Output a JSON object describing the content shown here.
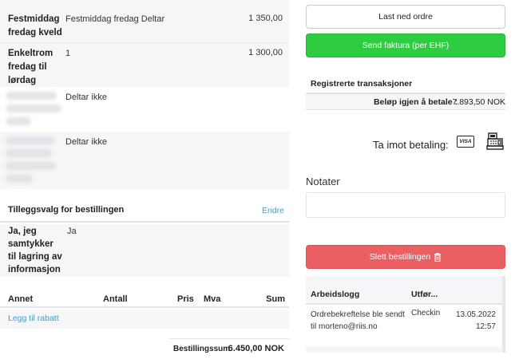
{
  "order_items": [
    {
      "name": "Festmiddag fredag kveld",
      "desc": "Festmiddag fredag Deltar",
      "amount": "1 350,00"
    },
    {
      "name": "Enkeltrom fredag til lørdag",
      "desc": "1",
      "amount": "1 300,00"
    },
    {
      "name": "",
      "desc": "Deltar ikke",
      "amount": ""
    },
    {
      "name": "",
      "desc": "Deltar ikke",
      "amount": ""
    }
  ],
  "addons": {
    "title": "Tilleggsvalg for bestillingen",
    "edit_link": "Endre",
    "consent_label": "Ja, jeg samtykker til lagring av informasjon",
    "consent_value": "Ja"
  },
  "extras_table": {
    "headers": [
      "Annet",
      "Antall",
      "Pris",
      "Mva",
      "Sum"
    ],
    "add_discount_link": "Legg til rabatt"
  },
  "total": {
    "label": "Bestillingssum",
    "value": "6.450,00 NOK"
  },
  "actions": {
    "download": "Last ned ordre",
    "send_invoice": "Send faktura (per EHF)",
    "delete": "Slett bestillingen"
  },
  "transactions": {
    "title": "Registrerte transaksjoner",
    "remaining_label": "Beløp igjen å betale :",
    "remaining_value": "7.893,50 NOK"
  },
  "payment": {
    "label": "Ta imot betaling:",
    "visa_text": "VISA",
    "icons": [
      "visa-card-icon",
      "cash-register-icon"
    ]
  },
  "notes": {
    "title": "Notater",
    "value": ""
  },
  "worklog": {
    "headers": [
      "Arbeidslogg",
      "Utfør..."
    ],
    "rows": [
      {
        "message": "Ordrebekreftelse ble sendt til morteno@riis.no",
        "by": "Checkin",
        "date": "13.05.2022",
        "time": "12:57"
      }
    ]
  },
  "colors": {
    "green": "#2ecc40",
    "red": "#ea5f61",
    "link": "#3aa0d8"
  }
}
